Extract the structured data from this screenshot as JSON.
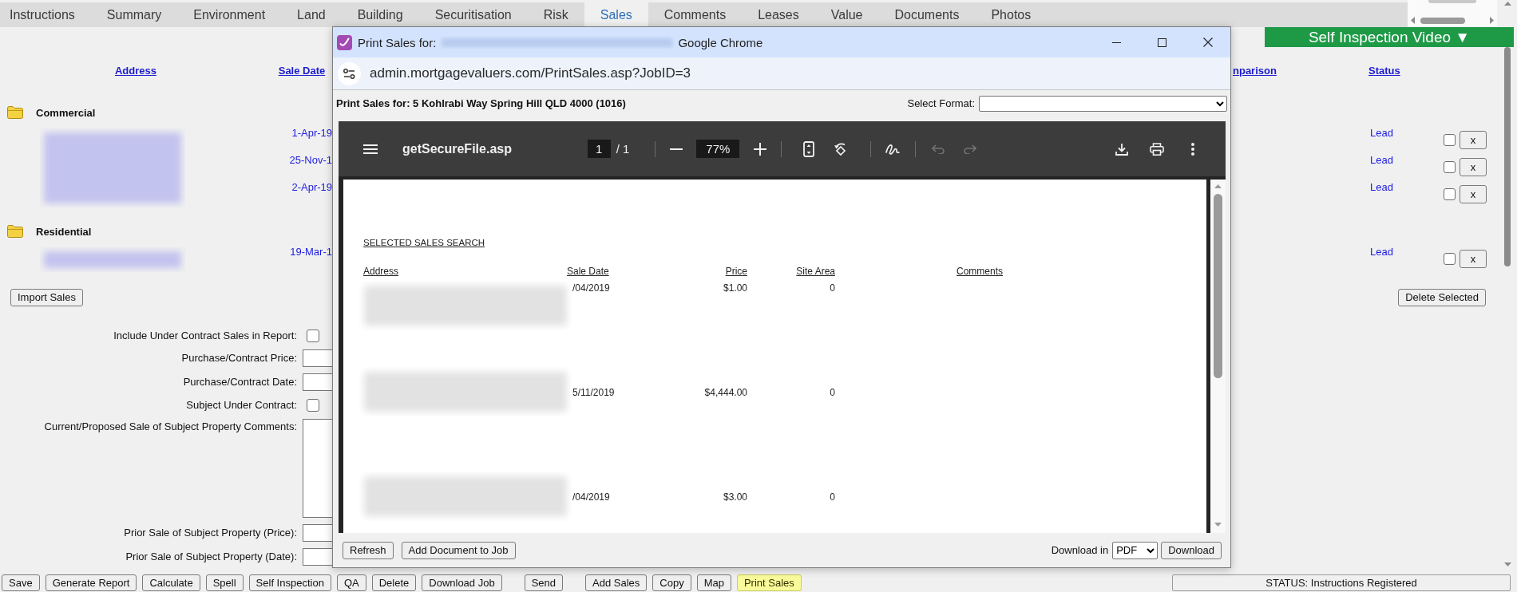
{
  "tabs": [
    {
      "label": "Instructions",
      "selected": false
    },
    {
      "label": "Summary",
      "selected": false
    },
    {
      "label": "Environment",
      "selected": false
    },
    {
      "label": "Land",
      "selected": false
    },
    {
      "label": "Building",
      "selected": false
    },
    {
      "label": "Securitisation",
      "selected": false
    },
    {
      "label": "Risk",
      "selected": false
    },
    {
      "label": "Sales",
      "selected": true
    },
    {
      "label": "Comments",
      "selected": false
    },
    {
      "label": "Leases",
      "selected": false
    },
    {
      "label": "Value",
      "selected": false
    },
    {
      "label": "Documents",
      "selected": false
    },
    {
      "label": "Photos",
      "selected": false
    }
  ],
  "video_button": {
    "label": "Self Inspection Video ▼"
  },
  "sales_table": {
    "columns": [
      {
        "label": "Address"
      },
      {
        "label": "Sale Date"
      },
      {
        "label": "nparison"
      },
      {
        "label": "Status"
      }
    ],
    "groups": [
      {
        "name": "Commercial",
        "rows": [
          {
            "sale_date": "1-Apr-19",
            "status": "Lead",
            "checked": false,
            "remove": "x"
          },
          {
            "sale_date": "25-Nov-1",
            "status": "Lead",
            "checked": false,
            "remove": "x"
          },
          {
            "sale_date": "2-Apr-19",
            "status": "Lead",
            "checked": false,
            "remove": "x"
          }
        ]
      },
      {
        "name": "Residential",
        "rows": [
          {
            "sale_date": "19-Mar-1",
            "status": "Lead",
            "checked": false,
            "remove": "x"
          }
        ]
      }
    ]
  },
  "sales_actions": {
    "import_button": "Import Sales",
    "delete_button": "Delete Selected"
  },
  "form": [
    {
      "kind": "checkbox",
      "label": "Include Under Contract Sales in Report:",
      "checked": false
    },
    {
      "kind": "input",
      "label": "Purchase/Contract Price:"
    },
    {
      "kind": "input",
      "label": "Purchase/Contract Date:"
    },
    {
      "kind": "checkbox",
      "label": "Subject Under Contract:",
      "checked": false
    },
    {
      "kind": "textarea",
      "label": "Current/Proposed Sale of Subject Property Comments:"
    },
    {
      "kind": "input",
      "label": "Prior Sale of Subject Property (Price):"
    },
    {
      "kind": "input",
      "label": "Prior Sale of Subject Property (Date):"
    }
  ],
  "toolbar": [
    {
      "buttons": [
        {
          "label": "Save",
          "highlighted": false
        },
        {
          "label": "Generate Report",
          "highlighted": false
        },
        {
          "label": "Calculate",
          "highlighted": false
        },
        {
          "label": "Spell",
          "highlighted": false
        },
        {
          "label": "Self Inspection",
          "highlighted": false
        },
        {
          "label": "QA",
          "highlighted": false
        },
        {
          "label": "Delete",
          "highlighted": false
        },
        {
          "label": "Download Job",
          "highlighted": false
        }
      ]
    },
    {
      "buttons": [
        {
          "label": "Send",
          "highlighted": false
        }
      ]
    },
    {
      "buttons": [
        {
          "label": "Add Sales",
          "highlighted": false
        },
        {
          "label": "Copy",
          "highlighted": false
        },
        {
          "label": "Map",
          "highlighted": false
        },
        {
          "label": "Print Sales",
          "highlighted": true
        }
      ]
    }
  ],
  "status_bar": {
    "text": "STATUS: Instructions Registered"
  },
  "popup": {
    "title": "Print Sales for:",
    "app_name": "Google Chrome",
    "url": "admin.mortgagevaluers.com/PrintSales.asp?JobID=3",
    "heading": "Print Sales for: 5 Kohlrabi Way Spring Hill QLD 4000 (1016)",
    "format_label": "Select Format:",
    "viewer": {
      "file_name": "getSecureFile.asp",
      "page": "1",
      "page_total": "/ 1",
      "zoom": "77%",
      "history": [
        {
          "kind": "undo",
          "disabled": true
        },
        {
          "kind": "redo",
          "disabled": true
        }
      ],
      "document": {
        "title": "SELECTED SALES SEARCH",
        "columns": [
          "Address",
          "Sale Date",
          "Price",
          "Site Area",
          "Comments"
        ],
        "rows": [
          {
            "sale_date": "/04/2019",
            "price": "$1.00",
            "site_area": "0"
          },
          {
            "sale_date": "5/11/2019",
            "price": "$4,444.00",
            "site_area": "0"
          },
          {
            "sale_date": "/04/2019",
            "price": "$3.00",
            "site_area": "0"
          }
        ]
      }
    },
    "buttons": [
      "Refresh",
      "Add Document to Job"
    ],
    "download_label": "Download in",
    "download_format": "PDF",
    "download_button": "Download"
  }
}
